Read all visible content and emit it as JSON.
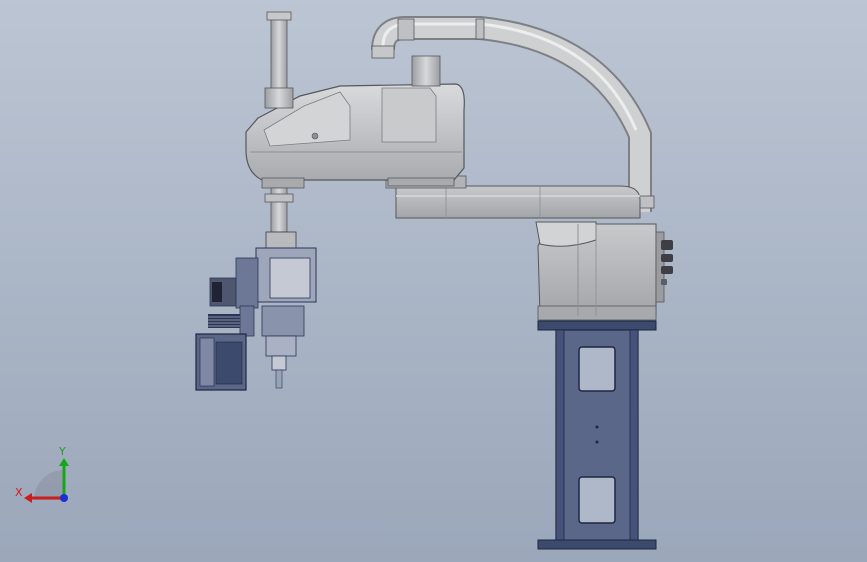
{
  "scene": {
    "description_free": true,
    "colors": {
      "background_top": "#bcc5d3",
      "background_bottom": "#9ba7ba",
      "robot_body": "#bcbdbe",
      "robot_shadow": "#8f9194",
      "robot_highlight": "#dcdddf",
      "stand_frame": "#3c4a6e",
      "stand_fill": "#5b6788",
      "tooling_dark": "#2c3555",
      "tooling_mid": "#6d7897"
    }
  },
  "triad": {
    "x_label": "X",
    "y_label": "Y",
    "x_color": "#cc1d1d",
    "y_color": "#17a51c",
    "z_color": "#1c2fd0"
  }
}
